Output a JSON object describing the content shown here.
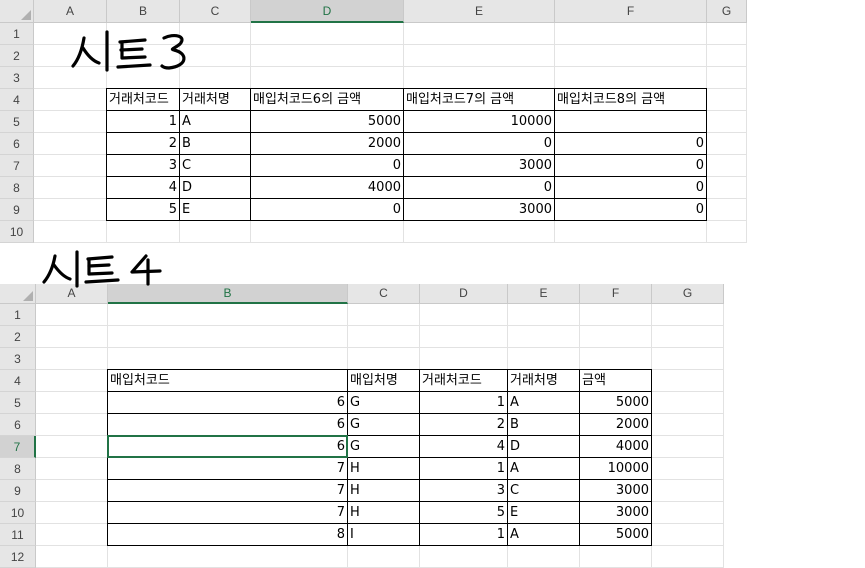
{
  "sheet3": {
    "handwritten_label": "시트 3",
    "col_headers": [
      "A",
      "B",
      "C",
      "D",
      "E",
      "F",
      "G"
    ],
    "row_headers": [
      "1",
      "2",
      "3",
      "4",
      "5",
      "6",
      "7",
      "8",
      "9",
      "10"
    ],
    "header_row": [
      "거래처코드",
      "거래처명",
      "매입처코드6의 금액",
      "매입처코드7의 금액",
      "매입처코드8의 금액"
    ],
    "rows": [
      [
        "1",
        "A",
        "5000",
        "10000",
        ""
      ],
      [
        "2",
        "B",
        "2000",
        "0",
        "0"
      ],
      [
        "3",
        "C",
        "0",
        "3000",
        "0"
      ],
      [
        "4",
        "D",
        "4000",
        "0",
        "0"
      ],
      [
        "5",
        "E",
        "0",
        "3000",
        "0"
      ]
    ],
    "selected_col": "D"
  },
  "sheet4": {
    "handwritten_label": "시트 4",
    "col_headers": [
      "A",
      "B",
      "C",
      "D",
      "E",
      "F",
      "G"
    ],
    "row_headers": [
      "1",
      "2",
      "3",
      "4",
      "5",
      "6",
      "7",
      "8",
      "9",
      "10",
      "11",
      "12"
    ],
    "header_row": [
      "매입처코드",
      "매입처명",
      "거래처코드",
      "거래처명",
      "금액"
    ],
    "rows": [
      [
        "6",
        "G",
        "1",
        "A",
        "5000"
      ],
      [
        "6",
        "G",
        "2",
        "B",
        "2000"
      ],
      [
        "6",
        "G",
        "4",
        "D",
        "4000"
      ],
      [
        "7",
        "H",
        "1",
        "A",
        "10000"
      ],
      [
        "7",
        "H",
        "3",
        "C",
        "3000"
      ],
      [
        "7",
        "H",
        "5",
        "E",
        "3000"
      ],
      [
        "8",
        "I",
        "1",
        "A",
        "5000"
      ]
    ],
    "selected_col": "B",
    "selected_row": "7"
  }
}
